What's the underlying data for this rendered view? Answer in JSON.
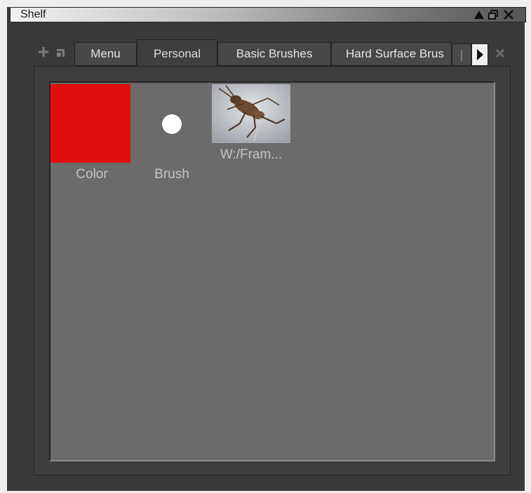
{
  "window": {
    "title": "Shelf",
    "controls": [
      "collapse-icon",
      "float-icon",
      "close-icon"
    ]
  },
  "toolbar": {
    "add_icon": "plus-icon",
    "menu_icon": "panel-menu-icon",
    "scroll_right_icon": "arrow-right-icon",
    "remove_icon": "x-icon"
  },
  "tabs": [
    {
      "label": "Menu",
      "active": false
    },
    {
      "label": "Personal",
      "active": true
    },
    {
      "label": "Basic Brushes",
      "active": false
    },
    {
      "label": "Hard Surface Brus",
      "active": false
    }
  ],
  "shelf_items": [
    {
      "label": "Color",
      "kind": "color-swatch",
      "color": "#e10d0d"
    },
    {
      "label": "Brush",
      "kind": "brush-dot",
      "color": "#ffffff"
    },
    {
      "label": "W:/Fram...",
      "kind": "image-thumbnail"
    }
  ]
}
